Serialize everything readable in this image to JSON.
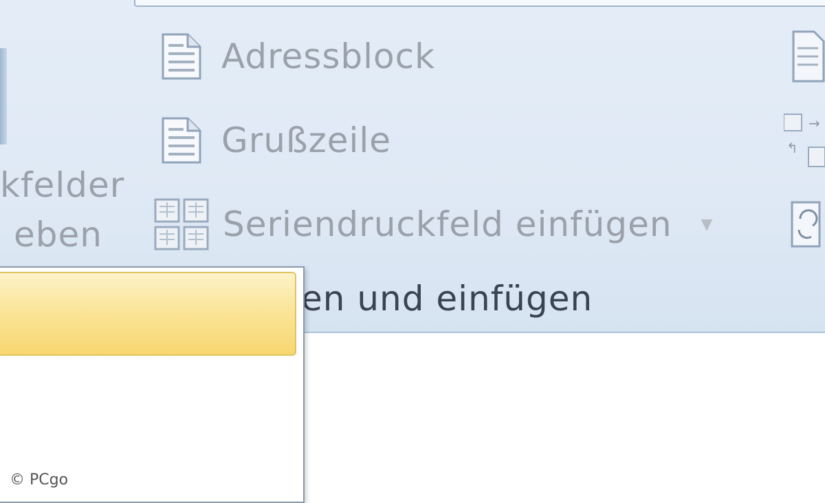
{
  "ribbon": {
    "commands": {
      "address_block": "Adressblock",
      "greeting_line": "Grußzeile",
      "insert_merge_field": "Seriendruckfeld einfügen"
    },
    "left_label_line1": "kfelder",
    "left_label_line2": "eben",
    "group_label": "en und einfügen"
  },
  "watermark": "© PCgo",
  "icons": {
    "address_block": "document-icon",
    "greeting_line": "document-icon",
    "insert_merge_field": "merge-field-grid-icon",
    "dropdown": "chevron-down-icon"
  }
}
